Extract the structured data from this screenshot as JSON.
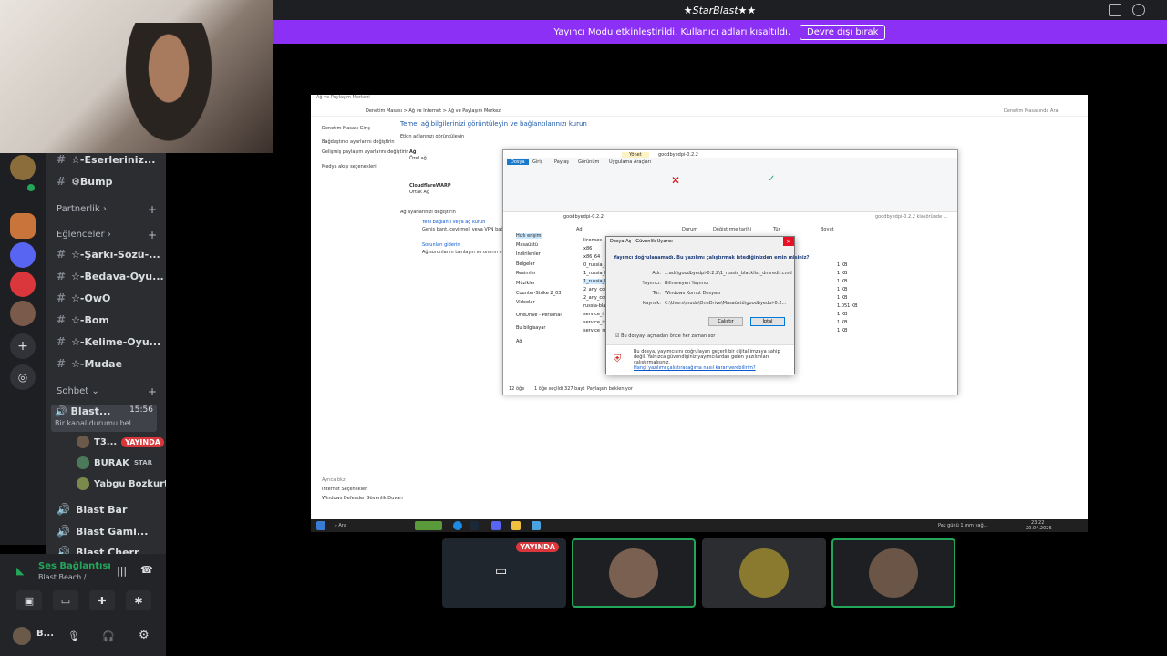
{
  "app": {
    "title": "★StarBlast★★",
    "streamer_banner": "Yayıncı Modu etkinleştirildi. Kullanıcı adları kısaltıldı.",
    "streamer_button": "Devre dışı bırak"
  },
  "channels": {
    "items_top": [
      {
        "label": "☆-Eserleriniz..."
      },
      {
        "label": "⚙Bump"
      }
    ],
    "category_partners": "Partnerlik",
    "category_fun": "Eğlenceler",
    "items_fun": [
      {
        "label": "☆-Şarkı-Sözü-..."
      },
      {
        "label": "☆-Bedava-Oyu..."
      },
      {
        "label": "☆-OwO"
      },
      {
        "label": "☆-Bom"
      },
      {
        "label": "☆-Kelime-Oyu..."
      },
      {
        "label": "☆-Mudae"
      }
    ],
    "category_chat": "Sohbet",
    "voice_active": {
      "label": "Blast...",
      "time": "15:56",
      "status": "Bir kanal durumu bel..."
    },
    "voice_users": [
      {
        "name": "T3...",
        "badge": "YAYINDA"
      },
      {
        "name": "BURAK",
        "badge": "STAR"
      },
      {
        "name": "Yabgu Bozkurt",
        "badge": ""
      }
    ],
    "voice_channels": [
      {
        "label": "Blast Bar"
      },
      {
        "label": "Blast Gami..."
      },
      {
        "label": "Blast Cherr..."
      }
    ]
  },
  "voice_panel": {
    "title": "Ses Bağlantısı",
    "subtitle": "Blast Beach / ...",
    "user": "B..."
  },
  "control_panel": {
    "window_title": "Ağ ve Paylaşım Merkezi",
    "breadcrumb": "Denetim Masası  >  Ağ ve İnternet  >  Ağ ve Paylaşım Merkezi",
    "search_placeholder": "Denetim Masasında Ara",
    "heading": "Temel ağ bilgilerinizi görüntüleyin ve bağlantılarınızı kurun",
    "active_networks": "Etkin ağlarınızı görüntüleyin",
    "left_links": [
      "Denetim Masası Giriş",
      "Bağdaştırıcı ayarlarını değiştirin",
      "Gelişmiş paylaşım ayarlarını değiştirin",
      "Medya akışı seçenekleri"
    ],
    "net1_name": "Ağ",
    "net1_type": "Özel ağ",
    "net2_name": "CloudflareWARP",
    "net2_type": "Ortak Ağ",
    "change_settings": "Ağ ayarlarınızı değiştirin",
    "new_conn": "Yeni bağlantı veya ağ kurun",
    "new_conn_desc": "Geniş bant, çevirmeli veya VPN bağlantısı",
    "troubleshoot": "Sorunları giderin",
    "troubleshoot_desc": "Ağ sorunlarını tanılayın ve onarın veya",
    "see_also": "Ayrıca bkz.",
    "see_also_links": [
      "Internet Seçenekleri",
      "Windows Defender Güvenlik Duvarı"
    ]
  },
  "explorer": {
    "title": "goodbyedpi-0.2.2",
    "context_tab": "Yönet",
    "tabs": [
      "Dosya",
      "Giriş",
      "Paylaş",
      "Görünüm",
      "Uygulama Araçları"
    ],
    "path": "goodbyedpi-0.2.2",
    "search": "goodbyedpi-0.2.2 klasöründe ...",
    "col_name": "Ad",
    "col_status": "Durum",
    "col_date": "Değiştirme tarihi",
    "col_type": "Tür",
    "col_size": "Boyut",
    "nav": [
      "Hızlı erişim",
      "Masaüstü",
      "İndirilenler",
      "Belgeler",
      "Resimler",
      "Müzikler",
      "Counter-Strike 2_03",
      "Videolar",
      "OneDrive - Personal",
      "Bu bilgisayar",
      "Ağ"
    ],
    "files": [
      "licenses",
      "x86",
      "x86_64",
      "0_russia_...",
      "1_russia_b...",
      "1_russia_b...",
      "2_any_cou...",
      "2_any_cou...",
      "russia-blac...",
      "service_ins...",
      "service_ins...",
      "service_re..."
    ],
    "sizes": [
      "1 KB",
      "1 KB",
      "1 KB",
      "1 KB",
      "1 KB",
      "1.051 KB",
      "1 KB",
      "1 KB",
      "1 KB"
    ],
    "status_items": "12 öğe",
    "status_selected": "1 öğe seçildi  327 bayt",
    "status_share": "Paylaşım bekleniyor"
  },
  "dialog": {
    "title": "Dosya Aç - Güvenlik Uyarısı",
    "question": "Yayımcı doğrulanamadı. Bu yazılımı çalıştırmak istediğinizden emin misiniz?",
    "fields": [
      {
        "k": "Adı:",
        "v": "...ads\\goodbyedpi-0.2.2\\1_russia_blacklist_dnsredir.cmd"
      },
      {
        "k": "Yayımcı:",
        "v": "Bilinmeyen Yayımcı"
      },
      {
        "k": "Tür:",
        "v": "Windows Komut Dosyası"
      },
      {
        "k": "Kaynak:",
        "v": "C:\\Users\\muda\\OneDrive\\Masaüstü\\goodbyedpi-0.2..."
      }
    ],
    "run_button": "Çalıştır",
    "cancel_button": "İptal",
    "checkbox": "Bu dosyayı açmadan önce her zaman sor",
    "warning": "Bu dosya, yayımcısını doğrulayan geçerli bir dijital imzaya sahip değil. Yalnızca güvendiğiniz yayımcılardan gelen yazılımları çalıştırmalısınız.",
    "warning_link": "Hangi yazılımı çalıştıracağıma nasıl karar verebilirim?"
  },
  "taskbar": {
    "search": "Ara",
    "weather": "Paz günü 1 mm yağ...",
    "time": "23:22",
    "date": "20.04.2026"
  },
  "stream_thumbs": {
    "live_badge": "YAYINDA"
  }
}
